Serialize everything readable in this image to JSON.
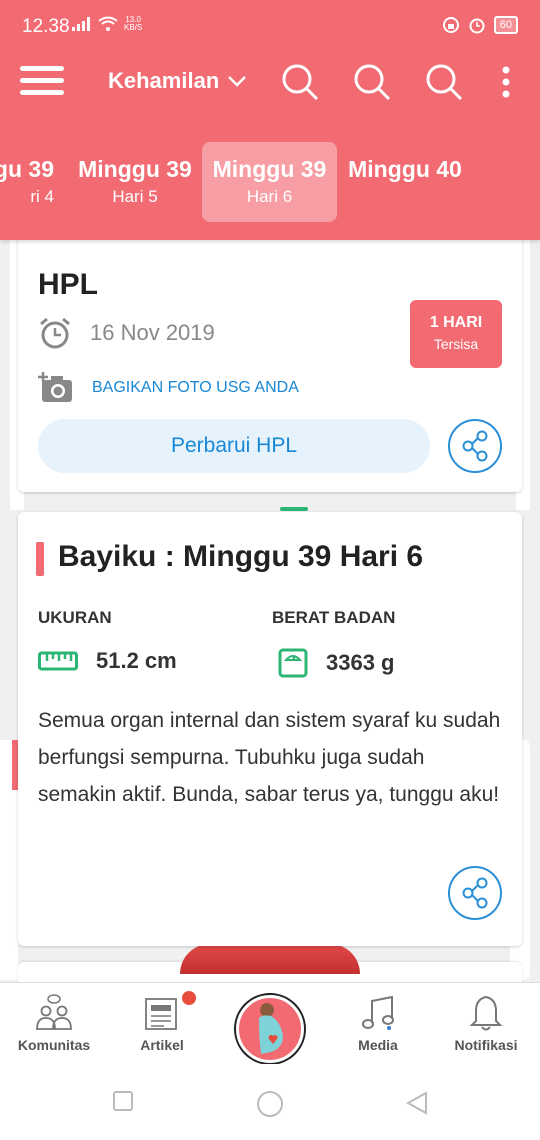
{
  "status_bar": {
    "time": "12.38",
    "speed_value": "13.0",
    "speed_unit": "KB/S",
    "battery": "60"
  },
  "toolbar": {
    "title": "Kehamilan"
  },
  "week_tabs": [
    {
      "main": "gu 39",
      "sub": "ri 4"
    },
    {
      "main": "Minggu 39",
      "sub": "Hari 5"
    },
    {
      "main": "Minggu 39",
      "sub": "Hari 6"
    },
    {
      "main": "Minggu 40",
      "sub": ""
    }
  ],
  "hpl_card": {
    "title": "HPL",
    "date": "16 Nov 2019",
    "remaining_main": "1 HARI",
    "remaining_sub": "Tersisa",
    "share_photo": "BAGIKAN FOTO USG ANDA",
    "update_button": "Perbarui HPL"
  },
  "baby_card": {
    "title": "Bayiku : Minggu 39 Hari 6",
    "size_label": "UKURAN",
    "size_value": "51.2 cm",
    "weight_label": "BERAT BADAN",
    "weight_value": "3363 g",
    "description": "Semua organ internal dan sistem syaraf ku sudah berfungsi sempurna. Tubuhku juga sudah semakin aktif. Bunda, sabar terus ya, tunggu aku!"
  },
  "bottom_nav": {
    "items": [
      {
        "label": "Komunitas"
      },
      {
        "label": "Artikel"
      },
      {
        "label": "Media"
      },
      {
        "label": "Notifikasi"
      }
    ]
  },
  "colors": {
    "brand": "#f26b73",
    "link": "#1787d6",
    "green": "#2bb673"
  }
}
